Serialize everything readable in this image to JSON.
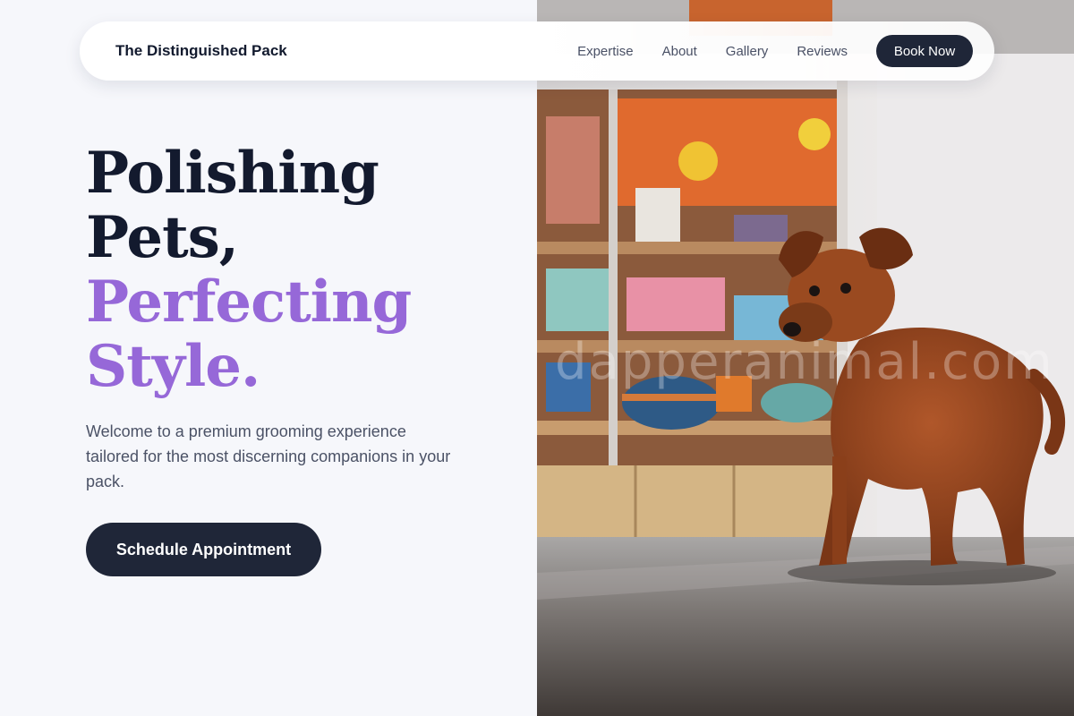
{
  "nav": {
    "brand": "The Distinguished Pack",
    "links": [
      "Expertise",
      "About",
      "Gallery",
      "Reviews"
    ],
    "cta_label": "Book Now"
  },
  "hero": {
    "headline_lines": [
      "Polishing",
      "Pets,"
    ],
    "accent_lines": [
      "Perfecting",
      "Style."
    ],
    "lead": "Welcome to a premium grooming experience tailored for the most discerning companions in your pack.",
    "cta_label": "Schedule Appointment",
    "image": {
      "subject": "brown-puppy-in-pet-store",
      "watermark": "dapperanimal.com"
    }
  },
  "colors": {
    "background": "#f6f7fb",
    "headline": "#131a2e",
    "accent": "#9668d8",
    "button": "#1f2638",
    "body_text": "#4b5266"
  }
}
